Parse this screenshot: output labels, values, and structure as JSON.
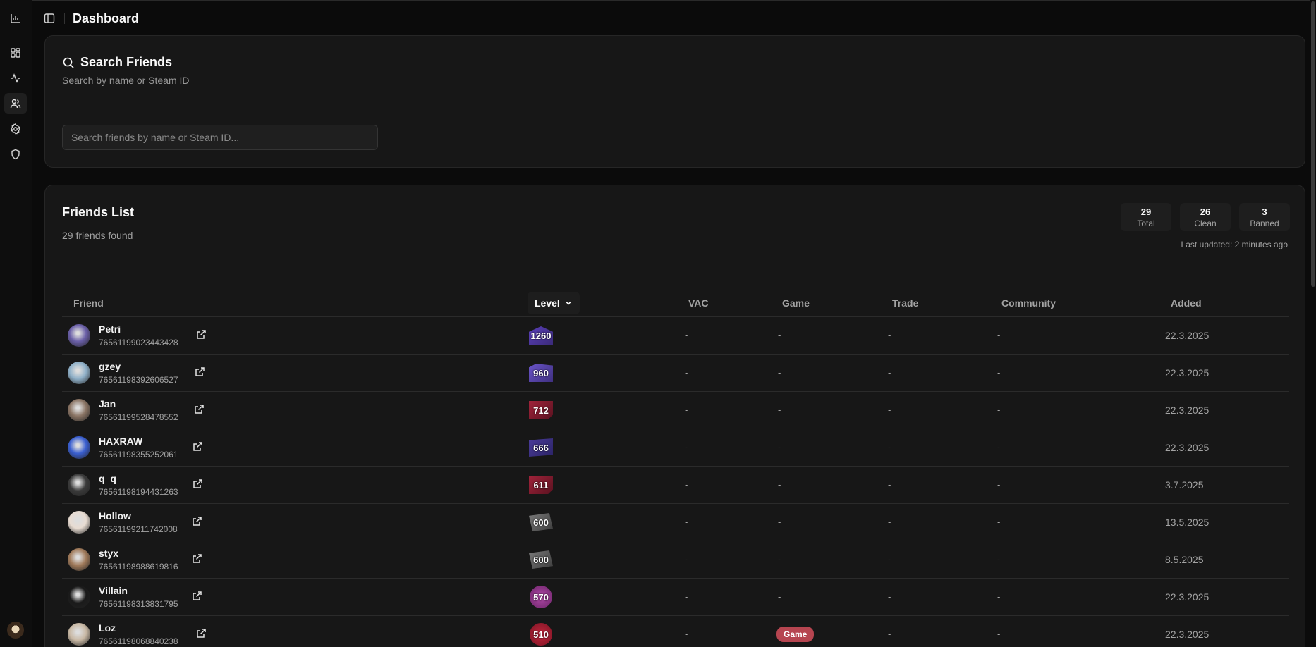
{
  "app": {
    "title": "Dashboard"
  },
  "rail": {
    "items": [
      {
        "icon": "bar-chart-icon"
      },
      {
        "icon": "dashboard-grid-icon"
      },
      {
        "icon": "activity-icon"
      },
      {
        "icon": "users-icon",
        "active": true
      },
      {
        "icon": "gear-icon"
      },
      {
        "icon": "shield-icon"
      }
    ]
  },
  "search": {
    "title": "Search Friends",
    "subtitle": "Search by name or Steam ID",
    "placeholder": "Search friends by name or Steam ID...",
    "value": ""
  },
  "friends": {
    "title": "Friends List",
    "count_text": "29 friends found",
    "stats": [
      {
        "value": "29",
        "label": "Total"
      },
      {
        "value": "26",
        "label": "Clean"
      },
      {
        "value": "3",
        "label": "Banned"
      }
    ],
    "last_updated": "Last updated: 2 minutes ago",
    "columns": {
      "friend": "Friend",
      "level": "Level",
      "vac": "VAC",
      "game": "Game",
      "trade": "Trade",
      "community": "Community",
      "added": "Added"
    },
    "rows": [
      {
        "name": "Petri",
        "id": "76561199023443428",
        "level": "1260",
        "level_style": "purple",
        "vac": "-",
        "game": "-",
        "trade": "-",
        "community": "-",
        "added": "22.3.2025",
        "avatar_color": "#6a5fa8"
      },
      {
        "name": "gzey",
        "id": "76561198392606527",
        "level": "960",
        "level_style": "purple2",
        "vac": "-",
        "game": "-",
        "trade": "-",
        "community": "-",
        "added": "22.3.2025",
        "avatar_color": "#8fb0c8"
      },
      {
        "name": "Jan",
        "id": "76561199528478552",
        "level": "712",
        "level_style": "red",
        "vac": "-",
        "game": "-",
        "trade": "-",
        "community": "-",
        "added": "22.3.2025",
        "avatar_color": "#8a7464"
      },
      {
        "name": "HAXRAW",
        "id": "76561198355252061",
        "level": "666",
        "level_style": "violet",
        "vac": "-",
        "game": "-",
        "trade": "-",
        "community": "-",
        "added": "22.3.2025",
        "avatar_color": "#3a5fd0"
      },
      {
        "name": "q_q",
        "id": "76561198194431263",
        "level": "611",
        "level_style": "red",
        "vac": "-",
        "game": "-",
        "trade": "-",
        "community": "-",
        "added": "3.7.2025",
        "avatar_color": "#3a3a3a"
      },
      {
        "name": "Hollow",
        "id": "76561199211742008",
        "level": "600",
        "level_style": "gray",
        "vac": "-",
        "game": "-",
        "trade": "-",
        "community": "-",
        "added": "13.5.2025",
        "avatar_color": "#e8dcd2"
      },
      {
        "name": "styx",
        "id": "76561198988619816",
        "level": "600",
        "level_style": "gray",
        "vac": "-",
        "game": "-",
        "trade": "-",
        "community": "-",
        "added": "8.5.2025",
        "avatar_color": "#a07a5a"
      },
      {
        "name": "Villain",
        "id": "76561198313831795",
        "level": "570",
        "level_style": "magenta",
        "vac": "-",
        "game": "-",
        "trade": "-",
        "community": "-",
        "added": "22.3.2025",
        "avatar_color": "#1a1a1a"
      },
      {
        "name": "Loz",
        "id": "76561198068840238",
        "level": "510",
        "level_style": "crimson",
        "vac": "-",
        "game": "Game",
        "trade": "-",
        "community": "-",
        "added": "22.3.2025",
        "avatar_color": "#c8b8a4"
      }
    ]
  }
}
